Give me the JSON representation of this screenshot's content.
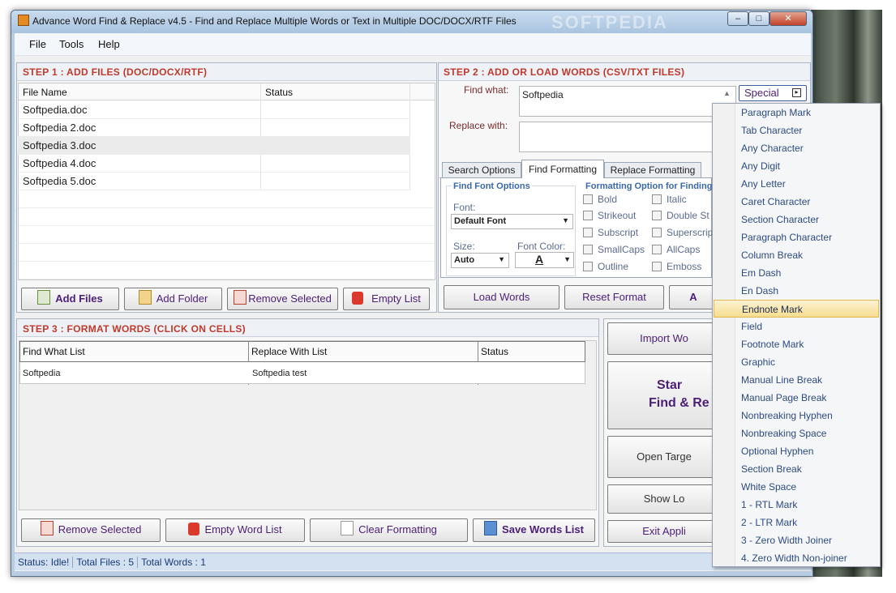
{
  "window": {
    "title": "Advance Word Find & Replace v4.5 - Find and Replace Multiple Words or Text in Multiple DOC/DOCX/RTF Files",
    "watermark": "SOFTPEDIA"
  },
  "menu": [
    "File",
    "Tools",
    "Help"
  ],
  "step1": {
    "title": "STEP 1 : ADD FILES (DOC/DOCX/RTF)",
    "columns": [
      "File Name",
      "Status"
    ],
    "files": [
      "Softpedia.doc",
      "Softpedia 2.doc",
      "Softpedia 3.doc",
      "Softpedia 4.doc",
      "Softpedia 5.doc"
    ],
    "buttons": {
      "add_files": "Add Files",
      "add_folder": "Add Folder",
      "remove_selected": "Remove Selected",
      "empty_list": "Empty List"
    }
  },
  "step2": {
    "title": "STEP 2 : ADD OR LOAD WORDS (CSV/TXT FILES)",
    "find_label": "Find what:",
    "find_value": "Softpedia",
    "replace_label": "Replace with:",
    "replace_value": "",
    "special_button": "Special",
    "tabs": [
      "Search Options",
      "Find Formatting",
      "Replace Formatting"
    ],
    "font_group_title": "Find Font Options",
    "font_label": "Font:",
    "font_value": "Default Font",
    "size_label": "Size:",
    "size_value": "Auto",
    "font_color_label": "Font Color:",
    "font_color_glyph": "A",
    "format_group_title": "Formatting Option for Finding W",
    "checks_left": [
      "Bold",
      "Strikeout",
      "Subscript",
      "SmallCaps",
      "Outline"
    ],
    "checks_right": [
      "Italic",
      "Double St",
      "Superscrip",
      "AllCaps",
      "Emboss"
    ],
    "buttons": {
      "load_words": "Load Words",
      "reset_format": "Reset Format",
      "add_partial": "A"
    }
  },
  "step3": {
    "title": "STEP 3 : FORMAT WORDS (CLICK ON CELLS)",
    "columns": [
      "Find What List",
      "Replace With List",
      "Status"
    ],
    "rows": [
      {
        "find": "Softpedia",
        "replace": "Softpedia test",
        "status": ""
      }
    ],
    "buttons": {
      "remove_selected": "Remove Selected",
      "empty_word_list": "Empty Word List",
      "clear_formatting": "Clear Formatting",
      "save_words_list": "Save Words List"
    }
  },
  "right_actions": {
    "import_words": "Import Wo",
    "start_line1": "Star",
    "start_line2": "Find & Re",
    "open_target": "Open Targe",
    "show_log": "Show Lo",
    "exit_app": "Exit Appli"
  },
  "special_menu": {
    "items": [
      "Paragraph Mark",
      "Tab Character",
      "Any Character",
      "Any Digit",
      "Any Letter",
      "Caret Character",
      "Section Character",
      "Paragraph Character",
      "Column Break",
      "Em Dash",
      "En Dash",
      "Endnote Mark",
      "Field",
      "Footnote Mark",
      "Graphic",
      "Manual Line Break",
      "Manual Page Break",
      "Nonbreaking Hyphen",
      "Nonbreaking Space",
      "Optional Hyphen",
      "Section Break",
      "White Space",
      "1 - RTL Mark",
      "2 - LTR Mark",
      "3 - Zero Width Joiner",
      "4. Zero Width Non-joiner"
    ],
    "highlighted": "Endnote Mark"
  },
  "status": {
    "status": "Status:  Idle!",
    "total_files": "Total Files : 5",
    "total_words": "Total Words : 1"
  },
  "colors": {
    "step_title": "#c0392b",
    "menu_text": "#2c4a83",
    "status_text": "#1a3a78"
  }
}
